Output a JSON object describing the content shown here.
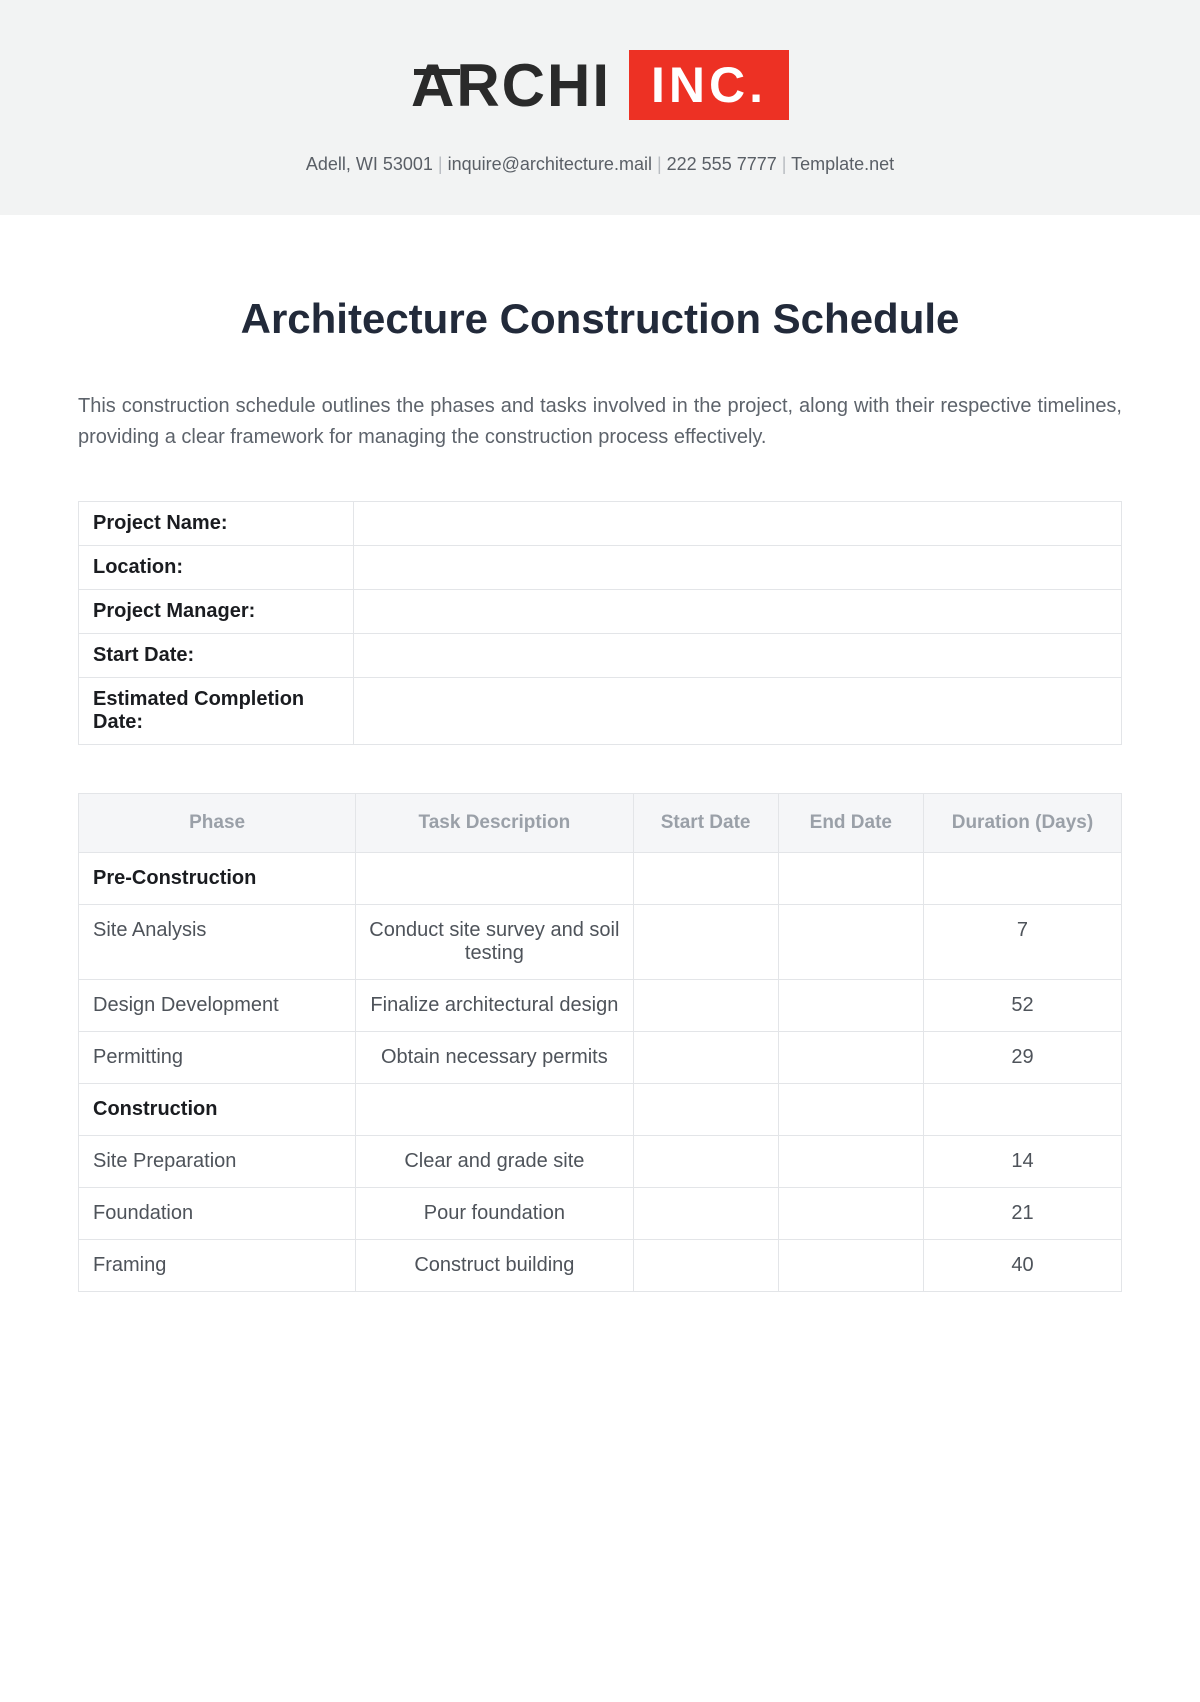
{
  "logo": {
    "part1": "ARCHI",
    "part2": "INC."
  },
  "contact": {
    "address": "Adell, WI 53001",
    "email": "inquire@architecture.mail",
    "phone": "222 555 7777",
    "site": "Template.net"
  },
  "title": "Architecture Construction Schedule",
  "intro": "This construction schedule outlines the phases and tasks involved in the project, along with their respective timelines, providing a clear framework for managing the construction process effectively.",
  "info": {
    "rows": [
      {
        "label": "Project Name:",
        "value": ""
      },
      {
        "label": "Location:",
        "value": ""
      },
      {
        "label": "Project Manager:",
        "value": ""
      },
      {
        "label": "Start Date:",
        "value": ""
      },
      {
        "label": "Estimated Completion Date:",
        "value": ""
      }
    ]
  },
  "schedule": {
    "headers": [
      "Phase",
      "Task Description",
      "Start Date",
      "End Date",
      "Duration (Days)"
    ],
    "rows": [
      {
        "type": "phase",
        "cells": [
          "Pre-Construction",
          "",
          "",
          "",
          ""
        ]
      },
      {
        "type": "task",
        "cells": [
          "Site Analysis",
          "Conduct site survey and soil testing",
          "",
          "",
          "7"
        ]
      },
      {
        "type": "task",
        "cells": [
          "Design Development",
          "Finalize architectural design",
          "",
          "",
          "52"
        ]
      },
      {
        "type": "task",
        "cells": [
          "Permitting",
          "Obtain necessary permits",
          "",
          "",
          "29"
        ]
      },
      {
        "type": "phase",
        "cells": [
          "Construction",
          "",
          "",
          "",
          ""
        ]
      },
      {
        "type": "task",
        "cells": [
          "Site Preparation",
          "Clear and grade site",
          "",
          "",
          "14"
        ]
      },
      {
        "type": "task",
        "cells": [
          "Foundation",
          "Pour foundation",
          "",
          "",
          "21"
        ]
      },
      {
        "type": "task",
        "cells": [
          "Framing",
          "Construct building",
          "",
          "",
          "40"
        ]
      }
    ]
  }
}
